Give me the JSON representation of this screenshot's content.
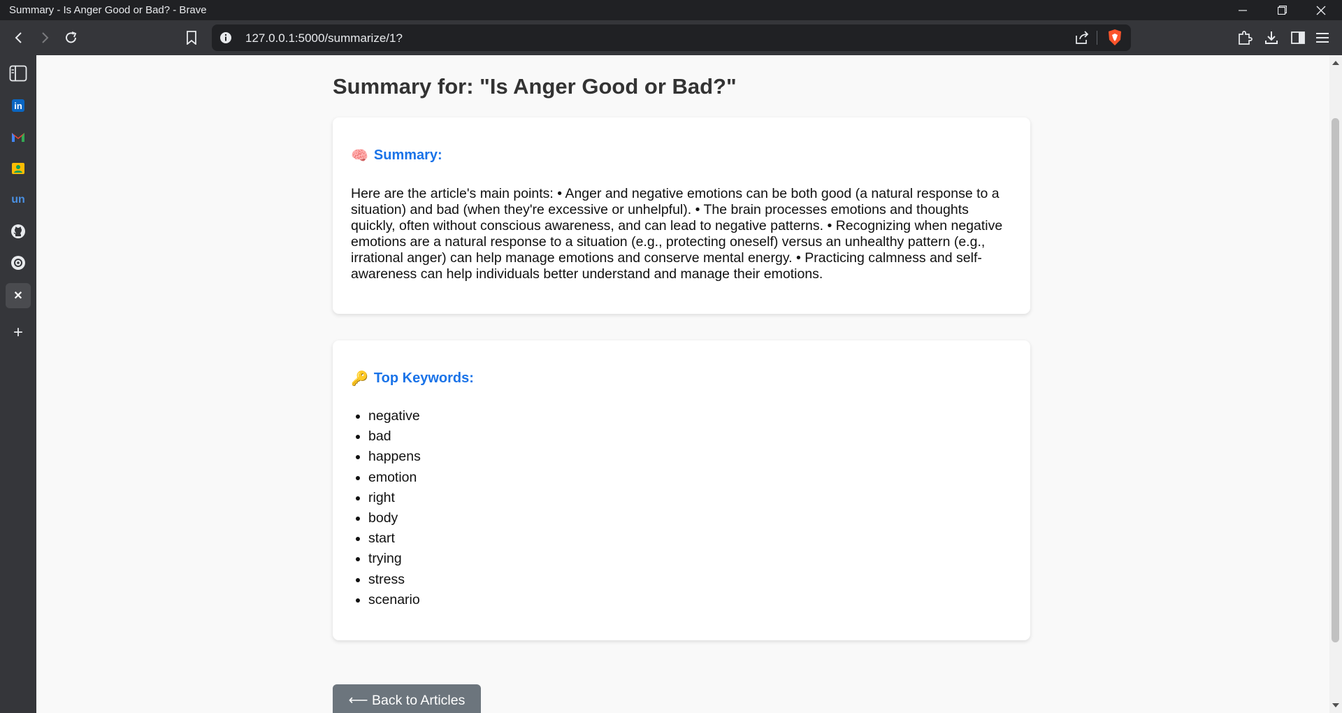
{
  "window": {
    "title": "Summary - Is Anger Good or Bad? - Brave"
  },
  "browser": {
    "url": "127.0.0.1:5000/summarize/1?"
  },
  "sidebar": {
    "items": [
      {
        "icon": "sidebar-panel-icon"
      },
      {
        "icon": "linkedin-icon",
        "label": "in"
      },
      {
        "icon": "gmail-icon",
        "label": "M"
      },
      {
        "icon": "contacts-icon"
      },
      {
        "icon": "unstop-icon",
        "label": "un"
      },
      {
        "icon": "github-icon"
      },
      {
        "icon": "chatgpt-icon"
      },
      {
        "icon": "x-icon",
        "label": "✕"
      },
      {
        "icon": "add-icon",
        "label": "+"
      }
    ]
  },
  "page": {
    "title": "Summary for: \"Is Anger Good or Bad?\"",
    "summary": {
      "emoji": "🧠",
      "heading": "Summary:",
      "text": "Here are the article's main points: • Anger and negative emotions can be both good (a natural response to a situation) and bad (when they're excessive or unhelpful). • The brain processes emotions and thoughts quickly, often without conscious awareness, and can lead to negative patterns. • Recognizing when negative emotions are a natural response to a situation (e.g., protecting oneself) versus an unhealthy pattern (e.g., irrational anger) can help manage emotions and conserve mental energy. • Practicing calmness and self-awareness can help individuals better understand and manage their emotions."
    },
    "keywords": {
      "emoji": "🔑",
      "heading": "Top Keywords:",
      "items": [
        "negative",
        "bad",
        "happens",
        "emotion",
        "right",
        "body",
        "start",
        "trying",
        "stress",
        "scenario"
      ]
    },
    "back_button": "⟵ Back to Articles"
  },
  "colors": {
    "accent": "#1a73e8",
    "button": "#6c757d",
    "chrome_dark": "#202124",
    "chrome": "#35363a"
  }
}
